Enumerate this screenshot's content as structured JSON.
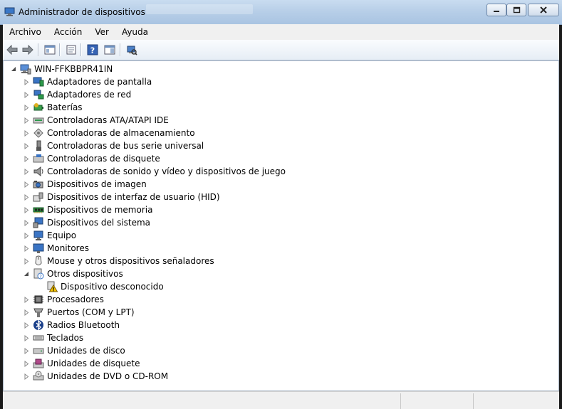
{
  "window": {
    "title": "Administrador de dispositivos"
  },
  "menubar": {
    "items": [
      "Archivo",
      "Acción",
      "Ver",
      "Ayuda"
    ]
  },
  "toolbar": {
    "buttons": [
      {
        "name": "back-button",
        "icon": "arrow-left-icon"
      },
      {
        "name": "forward-button",
        "icon": "arrow-right-icon"
      },
      {
        "name": "show-hide-console-tree-button",
        "icon": "console-tree-icon"
      },
      {
        "name": "properties-button",
        "icon": "properties-icon"
      },
      {
        "name": "help-button",
        "icon": "help-icon"
      },
      {
        "name": "action-pane-button",
        "icon": "action-pane-icon"
      },
      {
        "name": "scan-hardware-button",
        "icon": "scan-hardware-icon"
      }
    ]
  },
  "tree": {
    "root": {
      "label": "WIN-FFKBBPR41IN",
      "icon": "computer-network-icon"
    },
    "items": [
      {
        "label": "Adaptadores de pantalla",
        "icon": "display-adapter-icon",
        "expanded": false
      },
      {
        "label": "Adaptadores de red",
        "icon": "network-adapter-icon",
        "expanded": false
      },
      {
        "label": "Baterías",
        "icon": "battery-icon",
        "expanded": false
      },
      {
        "label": "Controladoras ATA/ATAPI IDE",
        "icon": "ide-controller-icon",
        "expanded": false
      },
      {
        "label": "Controladoras de almacenamiento",
        "icon": "storage-controller-icon",
        "expanded": false
      },
      {
        "label": "Controladoras de bus serie universal",
        "icon": "usb-icon",
        "expanded": false
      },
      {
        "label": "Controladoras de disquete",
        "icon": "floppy-controller-icon",
        "expanded": false
      },
      {
        "label": "Controladoras de sonido y vídeo y dispositivos de juego",
        "icon": "speaker-icon",
        "expanded": false
      },
      {
        "label": "Dispositivos de imagen",
        "icon": "camera-icon",
        "expanded": false
      },
      {
        "label": "Dispositivos de interfaz de usuario (HID)",
        "icon": "hid-icon",
        "expanded": false
      },
      {
        "label": "Dispositivos de memoria",
        "icon": "memory-icon",
        "expanded": false
      },
      {
        "label": "Dispositivos del sistema",
        "icon": "system-device-icon",
        "expanded": false
      },
      {
        "label": "Equipo",
        "icon": "computer-icon",
        "expanded": false
      },
      {
        "label": "Monitores",
        "icon": "monitor-icon",
        "expanded": false
      },
      {
        "label": "Mouse y otros dispositivos señaladores",
        "icon": "mouse-icon",
        "expanded": false
      },
      {
        "label": "Otros dispositivos",
        "icon": "unknown-device-icon",
        "expanded": true,
        "children": [
          {
            "label": "Dispositivo desconocido",
            "icon": "warning-device-icon"
          }
        ]
      },
      {
        "label": "Procesadores",
        "icon": "processor-icon",
        "expanded": false
      },
      {
        "label": "Puertos (COM y LPT)",
        "icon": "port-icon",
        "expanded": false
      },
      {
        "label": "Radios Bluetooth",
        "icon": "bluetooth-icon",
        "expanded": false
      },
      {
        "label": "Teclados",
        "icon": "keyboard-icon",
        "expanded": false
      },
      {
        "label": "Unidades de disco",
        "icon": "disk-drive-icon",
        "expanded": false
      },
      {
        "label": "Unidades de disquete",
        "icon": "floppy-drive-icon",
        "expanded": false
      },
      {
        "label": "Unidades de DVD o CD-ROM",
        "icon": "dvd-drive-icon",
        "expanded": false
      }
    ]
  },
  "colors": {
    "titlebar": "#b8cfe8",
    "selection": "#3399ff",
    "warning": "#f5c400"
  }
}
